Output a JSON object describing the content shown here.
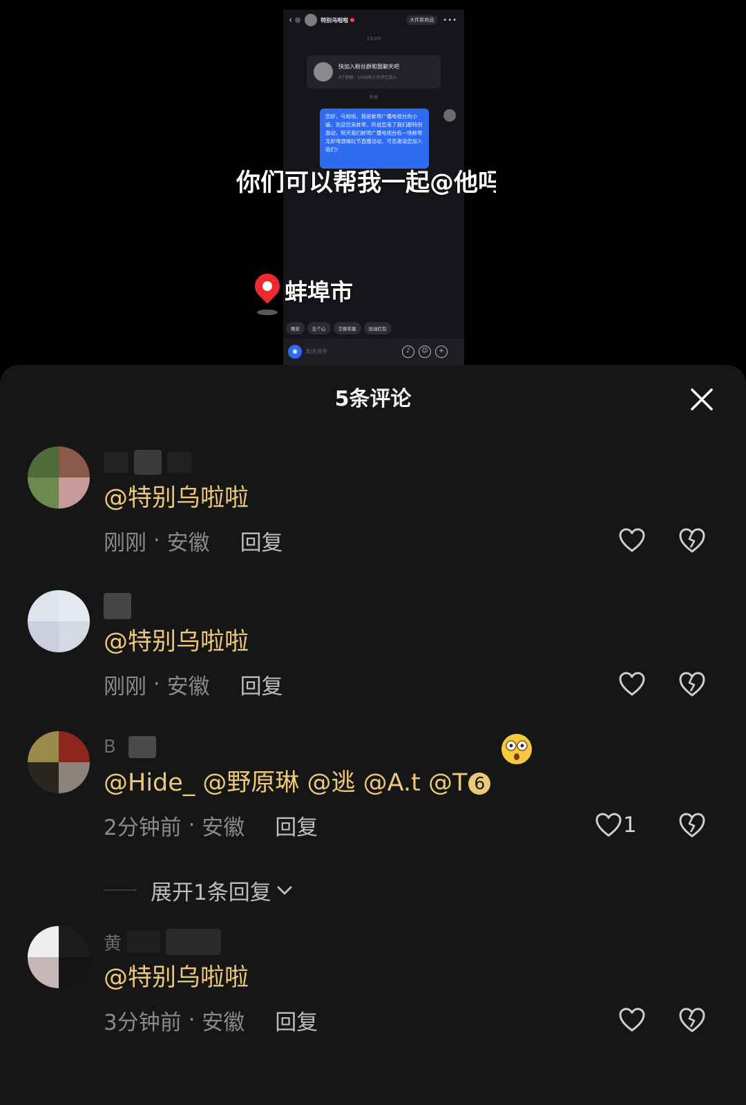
{
  "video": {
    "phone": {
      "contact_name": "特别乌啦啦",
      "shop_label": "大件新商品",
      "time": "23:09",
      "fan_card_title": "快加入粉丝群和我聊天吧",
      "fan_card_sub": "4个群聊 · 1059名小伙伴已加入",
      "small_label": "昨晚",
      "message": "您好，乌啦啦，我是蚌埠广播电视台的小编，欢迎您来蚌埠，听说您来了我们都特别激动，明天我们蚌埠广播电视台有一场蚌埠龙虾啤酒嗨玩节直播活动，可否邀请您加入我们?",
      "tags": [
        "晚安",
        "比个心",
        "交换答案",
        "加油红包"
      ],
      "input_placeholder": "发送消息"
    },
    "caption": "你们可以帮我一起@他吗",
    "location": "蚌埠市"
  },
  "sheet": {
    "title": "5条评论",
    "comments": [
      {
        "text": "@特别乌啦啦",
        "time": "刚刚",
        "region": "安徽",
        "reply": "回复"
      },
      {
        "text": "@特别乌啦啦",
        "time": "刚刚",
        "region": "安徽",
        "reply": "回复"
      },
      {
        "name_initial": "B",
        "text": "@Hide_ @野原琳 @逃 @A.t @T",
        "circled": "6",
        "time": "2分钟前",
        "region": "安徽",
        "reply": "回复",
        "likes": "1"
      },
      {
        "name_initial": "黄",
        "text": "@特别乌啦啦",
        "time": "3分钟前",
        "region": "安徽",
        "reply": "回复"
      }
    ],
    "expand_label": "展开1条回复"
  },
  "colors": {
    "mention": "#ecc979",
    "sheet_bg": "#161616",
    "meta": "#8a8a8a",
    "pin": "#f0292f",
    "bubble": "#2e6bf0"
  },
  "icons": {
    "close": "close-icon",
    "like": "heart-outline-icon",
    "dislike": "broken-heart-icon",
    "expand": "chevron-down-icon",
    "location": "location-pin-icon",
    "emoji": "astonished-face-emoji"
  }
}
